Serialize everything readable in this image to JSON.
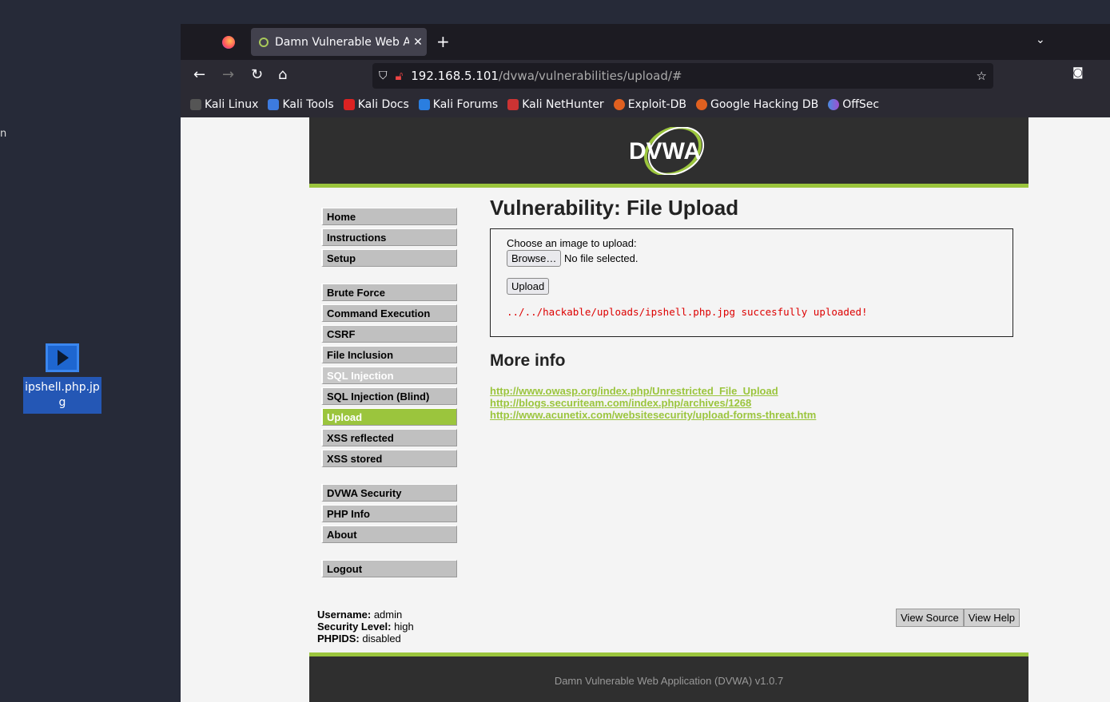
{
  "desktop": {
    "fragment": "n",
    "icon_label": "ipshell.php.jpg"
  },
  "browser": {
    "tab_title": "Damn Vulnerable Web Ap",
    "url_host": "192.168.5.101",
    "url_path": "/dvwa/vulnerabilities/upload/#",
    "bookmarks": [
      "Kali Linux",
      "Kali Tools",
      "Kali Docs",
      "Kali Forums",
      "Kali NetHunter",
      "Exploit-DB",
      "Google Hacking DB",
      "OffSec"
    ]
  },
  "dvwa": {
    "logo": "DVWA",
    "menu": [
      [
        "Home",
        "Instructions",
        "Setup"
      ],
      [
        "Brute Force",
        "Command Execution",
        "CSRF",
        "File Inclusion",
        "SQL Injection",
        "SQL Injection (Blind)",
        "Upload",
        "XSS reflected",
        "XSS stored"
      ],
      [
        "DVWA Security",
        "PHP Info",
        "About"
      ],
      [
        "Logout"
      ]
    ],
    "title": "Vulnerability: File Upload",
    "prompt": "Choose an image to upload:",
    "browse": "Browse…",
    "no_file": "No file selected.",
    "upload": "Upload",
    "result": "../../hackable/uploads/ipshell.php.jpg succesfully uploaded!",
    "more_info": "More info",
    "links": [
      "http://www.owasp.org/index.php/Unrestricted_File_Upload",
      "http://blogs.securiteam.com/index.php/archives/1268",
      "http://www.acunetix.com/websitesecurity/upload-forms-threat.htm"
    ],
    "username_label": "Username:",
    "username": "admin",
    "security_label": "Security Level:",
    "security": "high",
    "phpids_label": "PHPIDS:",
    "phpids": "disabled",
    "view_source": "View Source",
    "view_help": "View Help",
    "footer": "Damn Vulnerable Web Application (DVWA) v1.0.7"
  }
}
